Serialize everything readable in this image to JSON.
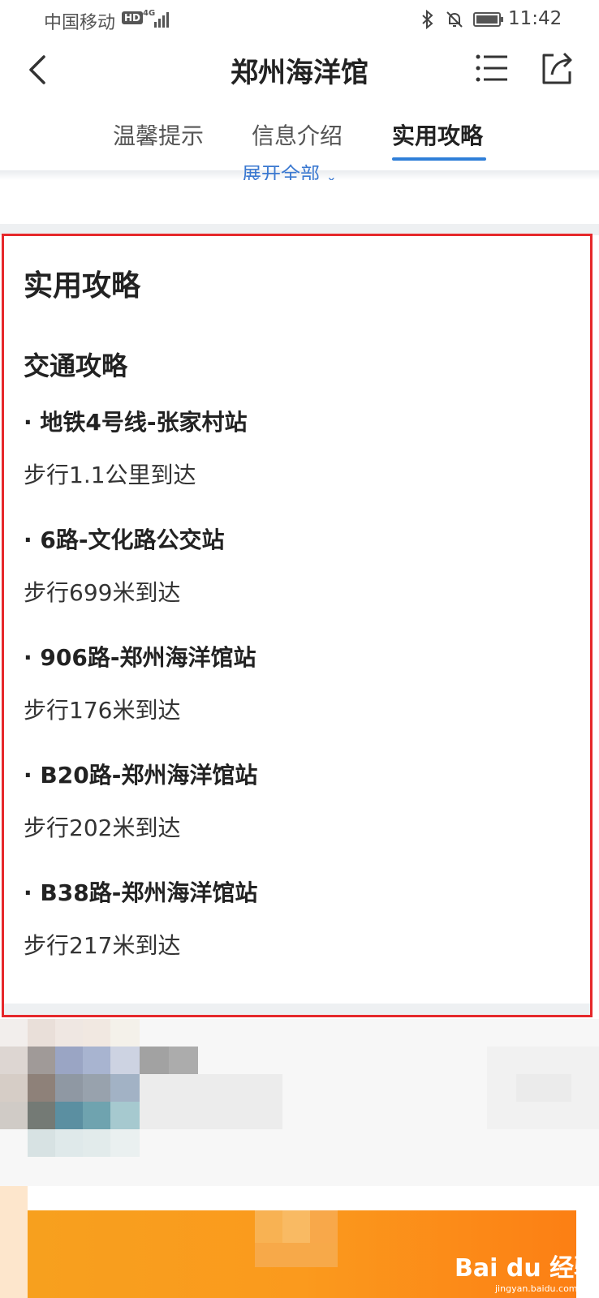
{
  "status_bar": {
    "carrier": "中国移动",
    "hd_badge": "HD",
    "network": "4G",
    "time": "11:42"
  },
  "header": {
    "title": "郑州海洋馆"
  },
  "tabs": [
    {
      "label": "温馨提示",
      "active": false
    },
    {
      "label": "信息介绍",
      "active": false
    },
    {
      "label": "实用攻略",
      "active": true
    }
  ],
  "expand_link": "展开全部",
  "guide": {
    "section_title": "实用攻略",
    "sub_title": "交通攻略",
    "routes": [
      {
        "name": "· 地铁4号线-张家村站",
        "walk": "步行1.1公里到达"
      },
      {
        "name": "· 6路-文化路公交站",
        "walk": "步行699米到达"
      },
      {
        "name": "· 906路-郑州海洋馆站",
        "walk": "步行176米到达"
      },
      {
        "name": "· B20路-郑州海洋馆站",
        "walk": "步行202米到达"
      },
      {
        "name": "· B38路-郑州海洋馆站",
        "walk": "步行217米到达"
      }
    ]
  },
  "watermark": {
    "brand": "Bai du 经验",
    "url": "jingyan.baidu.com"
  },
  "colors": {
    "accent_blue": "#2f7fd8",
    "highlight_red": "#e6282b",
    "banner_orange": "#fb9a1d"
  },
  "icons": [
    "back-icon",
    "menu-icon",
    "share-icon",
    "bluetooth-icon",
    "bell-off-icon",
    "battery-icon",
    "signal-icon",
    "chevron-down-icon"
  ]
}
